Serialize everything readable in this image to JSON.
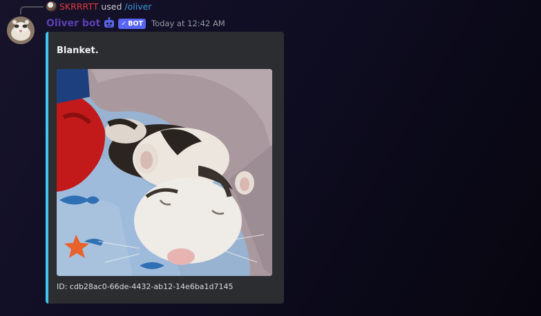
{
  "reply": {
    "username": "SKRRRTT",
    "used_text": "used",
    "command": "/oliver"
  },
  "message": {
    "author": "Oliver bot",
    "bot_badge": "BOT",
    "timestamp": "Today at 12:42 AM"
  },
  "embed": {
    "title": "Blanket.",
    "footer": "ID: cdb28ac0-66de-4432-ab12-14e6ba1d7145",
    "accent_color": "#3ec6f0"
  },
  "colors": {
    "username": "#e53b3b",
    "command": "#3b97d9",
    "bot_name": "#5b3fb5",
    "badge": "#5865f2"
  }
}
